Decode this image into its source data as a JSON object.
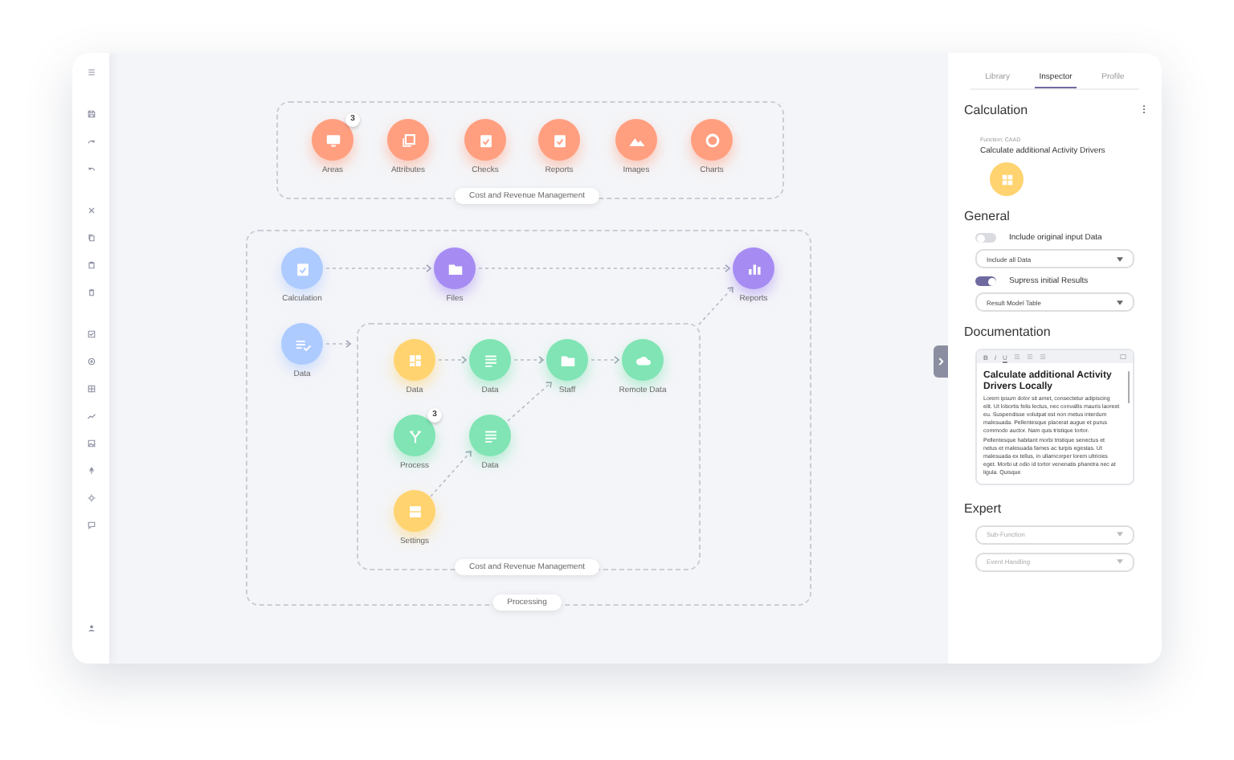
{
  "canvas": {
    "top_group": {
      "label": "Cost and Revenue Management",
      "nodes": [
        {
          "label": "Areas",
          "color": "#ff9f80",
          "badge": "3"
        },
        {
          "label": "Attributes",
          "color": "#ff9f80"
        },
        {
          "label": "Checks",
          "color": "#ff9f80"
        },
        {
          "label": "Reports",
          "color": "#ff9f80"
        },
        {
          "label": "Images",
          "color": "#ff9f80"
        },
        {
          "label": "Charts",
          "color": "#ff9f80"
        }
      ]
    },
    "processing_group": {
      "label": "Processing",
      "nodes": [
        {
          "label": "Calculation",
          "color": "#aecbff"
        },
        {
          "label": "Files",
          "color": "#a68cf2"
        },
        {
          "label": "Reports",
          "color": "#a68cf2"
        },
        {
          "label": "Data",
          "color": "#aecbff"
        }
      ]
    },
    "inner_group": {
      "label": "Cost and Revenue Management",
      "nodes": [
        {
          "label": "Data",
          "color": "#ffd36f"
        },
        {
          "label": "Data",
          "color": "#80e4b4"
        },
        {
          "label": "Staff",
          "color": "#80e4b4"
        },
        {
          "label": "Remote Data",
          "color": "#80e4b4"
        },
        {
          "label": "Process",
          "color": "#80e4b4",
          "badge": "3"
        },
        {
          "label": "Data",
          "color": "#80e4b4"
        },
        {
          "label": "Settings",
          "color": "#ffd36f"
        }
      ]
    }
  },
  "panel": {
    "tabs": [
      {
        "label": "Library",
        "selected": false
      },
      {
        "label": "Inspector",
        "selected": true
      },
      {
        "label": "Profile",
        "selected": false
      }
    ],
    "section_title": "Calculation",
    "function_label": "Function:  CAAD",
    "function_name": "Calculate additional Activity Drivers",
    "general": {
      "title": "General",
      "options": [
        {
          "label": "Include original input Data",
          "on": false,
          "dropdown": "Include all Data"
        },
        {
          "label": "Supress initial Results",
          "on": true,
          "dropdown": "Result Model Table"
        }
      ]
    },
    "documentation": {
      "title": "Documentation",
      "format_buttons": [
        "B",
        "I",
        "U"
      ],
      "heading": "Calculate additional Activity Drivers Locally",
      "body": "Lorem ipsum dolor sit amet, consectetur adipiscing elit. Ut lobortis felis lectus, nec convallis mauris laoreet eu. Suspendisse volutpat est non metus interdum malesuada. Pellentesque placerat augue et purus commodo auctor. Nam quis tristique tortor. Pellentesque habitant morbi tristique senectus et netus et malesuada fames ac turpis egestas. Ut malesuada ex tellus, in ullamcorper lorem ultricies eget. Morbi ut odio id tortor venenatis pharetra nec at ligula. Quisque"
    },
    "expert": {
      "title": "Expert",
      "fields": [
        {
          "placeholder": "Sub-Function"
        },
        {
          "placeholder": "Event Handling"
        }
      ]
    }
  }
}
